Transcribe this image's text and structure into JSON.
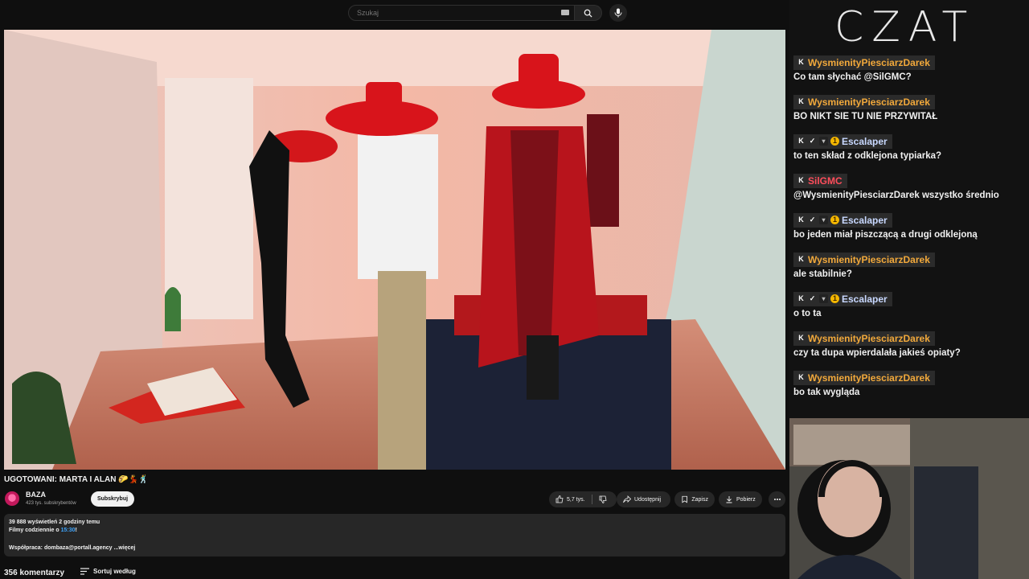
{
  "search": {
    "placeholder": "Szukaj"
  },
  "video": {
    "title": "UGOTOWANI: MARTA I ALAN 🌮💃🕺",
    "channel": {
      "name": "BAZA",
      "subscribers": "423 tys. subskrybentów",
      "subscribe_label": "Subskrybuj"
    },
    "actions": {
      "likes": "5,7 tys.",
      "share": "Udostępnij",
      "save": "Zapisz",
      "download": "Pobierz"
    },
    "description": {
      "stats": "39 888 wyświetleń  2 godziny temu",
      "line2_prefix": "Filmy codziennie o ",
      "line2_time": "15:30",
      "line2_suffix": "!",
      "line3": "Współpraca: dombaza@portall.agency  ...więcej"
    },
    "comments_count": "356 komentarzy",
    "sort_label": "Sortuj według"
  },
  "chat": {
    "title": "CZAT",
    "messages": [
      {
        "user": "WysmienityPiesciarzDarek",
        "color": "#f2a93b",
        "badges": [
          "kick"
        ],
        "text": "Co tam słychać @SilGMC?"
      },
      {
        "user": "WysmienityPiesciarzDarek",
        "color": "#f2a93b",
        "badges": [
          "kick"
        ],
        "text": "BO NIKT SIE TU NIE PRZYWITAŁ"
      },
      {
        "user": "Escalaper",
        "color": "#c8d8ff",
        "badges": [
          "kick",
          "verified",
          "sub",
          "coin"
        ],
        "text": "to ten skład z odklejona typiarka?"
      },
      {
        "user": "SilGMC",
        "color": "#ff4d5b",
        "badges": [
          "kick"
        ],
        "text": "@WysmienityPiesciarzDarek wszystko średnio"
      },
      {
        "user": "Escalaper",
        "color": "#c8d8ff",
        "badges": [
          "kick",
          "verified",
          "sub",
          "coin"
        ],
        "text": "bo jeden miał piszczącą a drugi odklejoną"
      },
      {
        "user": "WysmienityPiesciarzDarek",
        "color": "#f2a93b",
        "badges": [
          "kick"
        ],
        "text": "ale stabilnie?"
      },
      {
        "user": "Escalaper",
        "color": "#c8d8ff",
        "badges": [
          "kick",
          "verified",
          "sub",
          "coin"
        ],
        "text": "o to ta"
      },
      {
        "user": "WysmienityPiesciarzDarek",
        "color": "#f2a93b",
        "badges": [
          "kick"
        ],
        "text": "czy ta dupa wpierdalała jakieś opiaty?"
      },
      {
        "user": "WysmienityPiesciarzDarek",
        "color": "#f2a93b",
        "badges": [
          "kick"
        ],
        "text": "bo tak wygląda"
      }
    ]
  },
  "badge_glyphs": {
    "kick": "K",
    "verified": "✓",
    "sub": "▾",
    "coin": "1"
  }
}
